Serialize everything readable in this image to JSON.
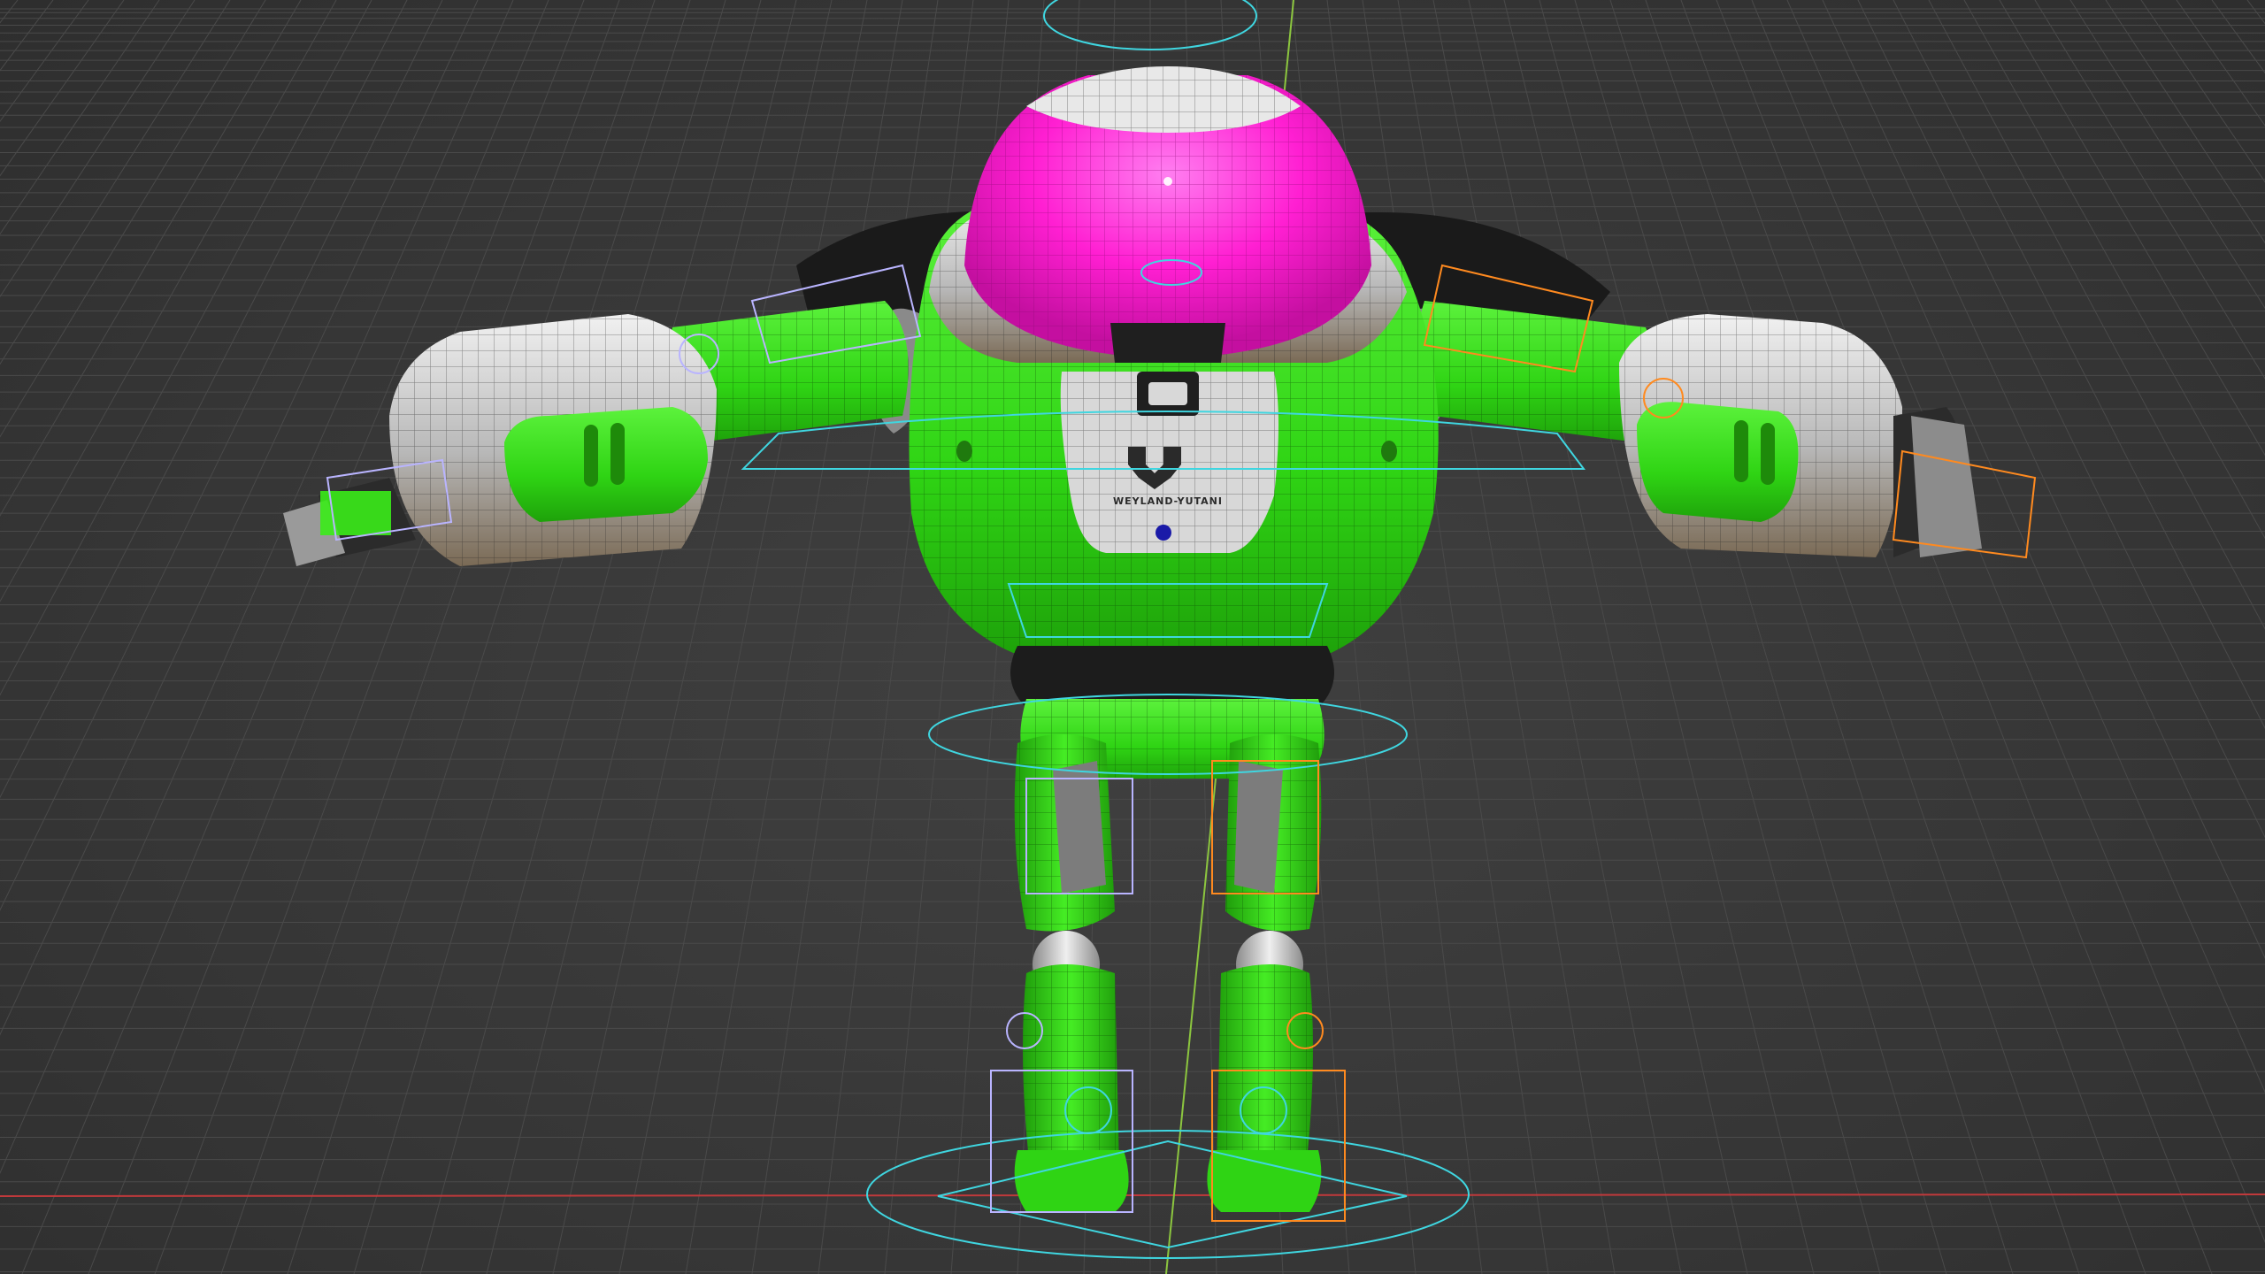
{
  "viewport": {
    "background_color": "#3a3a3a",
    "grid_color": "#4a4a4a",
    "x_axis_color": "#c0393b",
    "y_axis_color": "#8cc63f"
  },
  "model": {
    "body_color": "#35e21a",
    "dome_color": "#ff1fd2",
    "shell_color": "#c9c9c9",
    "dark_color": "#1c1c1c",
    "chest_emblem_text": "WEYLAND-YUTANI"
  },
  "rig": {
    "control_color": "#3fd6e0",
    "selected_bone_color": "#ff8a1f",
    "bone_color": "#b9b4ff"
  }
}
